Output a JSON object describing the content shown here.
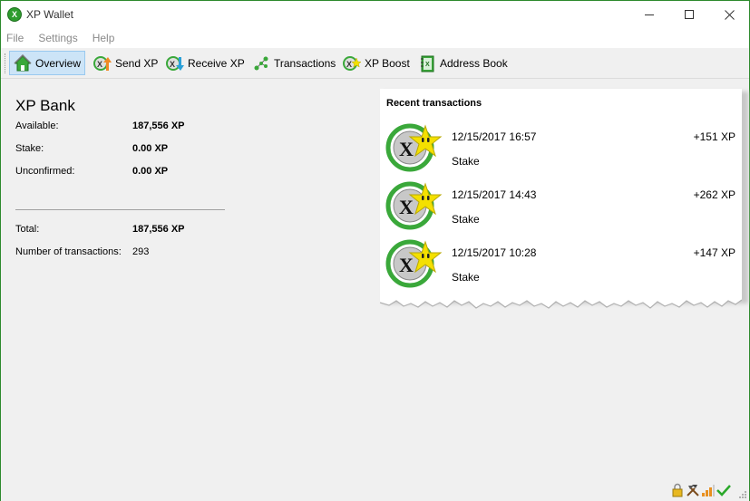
{
  "window": {
    "title": "XP Wallet"
  },
  "menu": [
    {
      "label": "File"
    },
    {
      "label": "Settings"
    },
    {
      "label": "Help"
    }
  ],
  "toolbar": {
    "overview": "Overview",
    "send": "Send XP",
    "receive": "Receive XP",
    "transactions": "Transactions",
    "boost": "XP Boost",
    "address_book": "Address Book"
  },
  "overview": {
    "title": "XP Bank",
    "available_label": "Available:",
    "available_value": "187,556  XP",
    "stake_label": "Stake:",
    "stake_value": "0.00 XP",
    "unconfirmed_label": "Unconfirmed:",
    "unconfirmed_value": "0.00 XP",
    "total_label": "Total:",
    "total_value": "187,556  XP",
    "num_tx_label": "Number of transactions:",
    "num_tx_value": "293"
  },
  "recent": {
    "title": "Recent transactions",
    "items": [
      {
        "date": "12/15/2017 16:57",
        "type": "Stake",
        "amount": "+151 XP"
      },
      {
        "date": "12/15/2017 14:43",
        "type": "Stake",
        "amount": "+262 XP"
      },
      {
        "date": "12/15/2017 10:28",
        "type": "Stake",
        "amount": "+147 XP"
      }
    ]
  },
  "colors": {
    "accent_green": "#2e9c2e",
    "star_yellow": "#f4e000",
    "active_tab": "#cce4f7"
  },
  "icons": {
    "app": "xp-logo-icon",
    "overview": "home-icon",
    "send": "send-arrow-icon",
    "receive": "receive-arrow-icon",
    "transactions": "transactions-network-icon",
    "boost": "boost-star-icon",
    "address_book": "address-book-icon",
    "status": [
      "lock-icon",
      "mining-tools-icon",
      "signal-bars-icon",
      "synced-check-icon"
    ]
  }
}
